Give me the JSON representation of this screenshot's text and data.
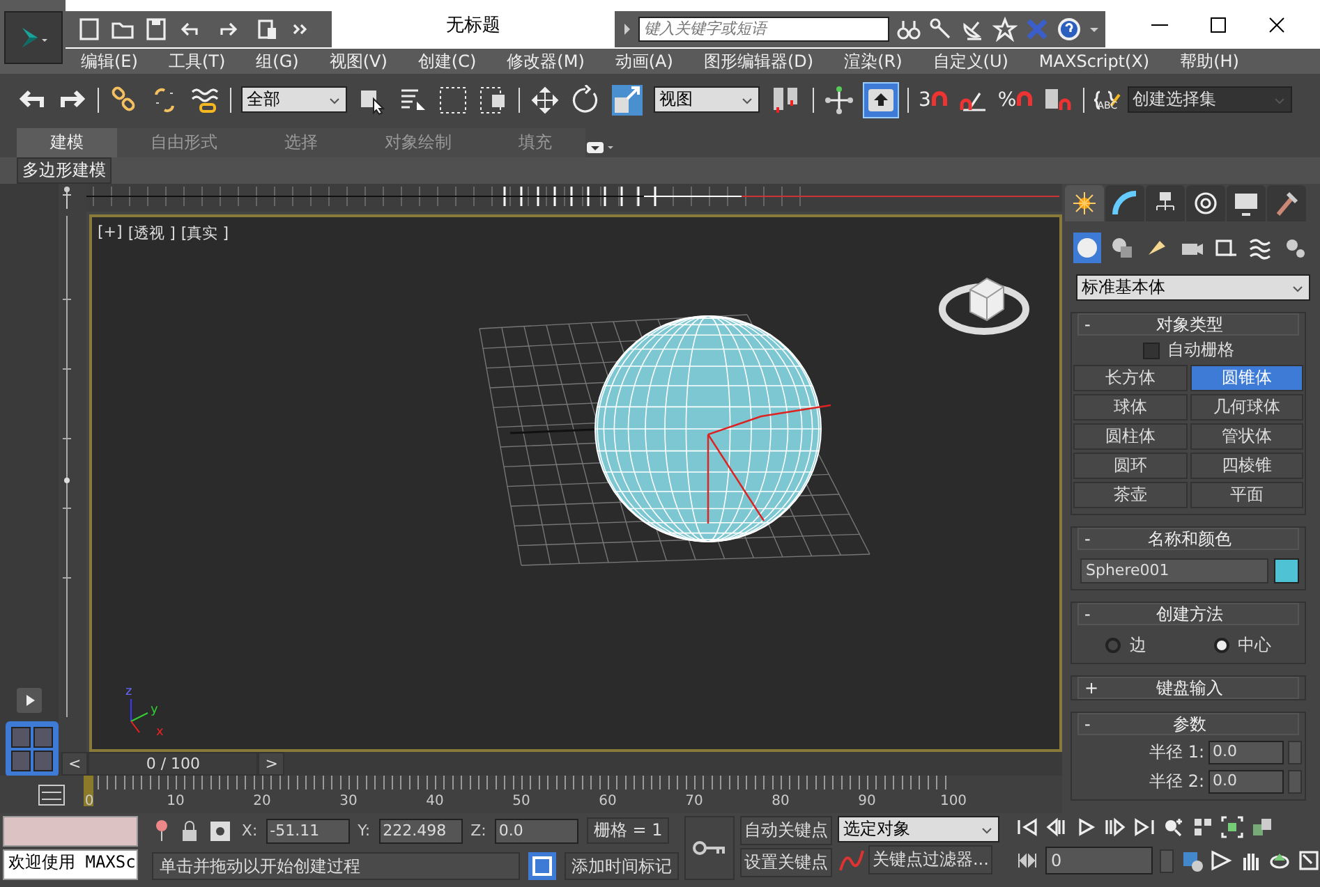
{
  "title_bar": {
    "title": "无标题",
    "search": {
      "placeholder": "键入关键字或短语"
    }
  },
  "menu": [
    "编辑(E)",
    "工具(T)",
    "组(G)",
    "视图(V)",
    "创建(C)",
    "修改器(M)",
    "动画(A)",
    "图形编辑器(D)",
    "渲染(R)",
    "自定义(U)",
    "MAXScript(X)",
    "帮助(H)"
  ],
  "toolbar": {
    "selection_filter": "全部",
    "reference_coord": "视图",
    "named_selection": "创建选择集",
    "keyboard_override": {
      "on": true
    },
    "snap_label": "3",
    "percent_label": "%",
    "named_sets_label": "ABC"
  },
  "ribbon": {
    "tabs": [
      {
        "label": "建模",
        "selected": true
      },
      {
        "label": "自由形式",
        "selected": false
      },
      {
        "label": "选择",
        "selected": false
      },
      {
        "label": "对象绘制",
        "selected": false
      },
      {
        "label": "填充",
        "selected": false
      }
    ],
    "panel_label": "多边形建模"
  },
  "viewport": {
    "labels": [
      "[+]",
      "[透视 ]",
      "[真实 ]"
    ],
    "axis_labels": [
      "x",
      "y",
      "z"
    ]
  },
  "command_panel": {
    "tabs": [
      {
        "kind": "create",
        "selected": true
      },
      {
        "kind": "modify",
        "selected": false
      },
      {
        "kind": "hierarchy",
        "selected": false
      },
      {
        "kind": "motion",
        "selected": false
      },
      {
        "kind": "display",
        "selected": false
      },
      {
        "kind": "utilities",
        "selected": false
      }
    ],
    "subtabs": [
      {
        "kind": "geometry",
        "selected": true
      },
      {
        "kind": "shapes",
        "selected": false
      },
      {
        "kind": "lights",
        "selected": false
      },
      {
        "kind": "cameras",
        "selected": false
      },
      {
        "kind": "helpers",
        "selected": false
      },
      {
        "kind": "spacewarps",
        "selected": false
      },
      {
        "kind": "systems",
        "selected": false
      }
    ],
    "category": "标准基本体",
    "rollouts": [
      {
        "kind": "object_type",
        "sign": "-",
        "title": "对象类型",
        "auto_grid": {
          "label": "自动栅格",
          "checked": false
        },
        "buttons": [
          {
            "label": "长方体",
            "selected": false
          },
          {
            "label": "圆锥体",
            "selected": true
          },
          {
            "label": "球体",
            "selected": false
          },
          {
            "label": "几何球体",
            "selected": false
          },
          {
            "label": "圆柱体",
            "selected": false
          },
          {
            "label": "管状体",
            "selected": false
          },
          {
            "label": "圆环",
            "selected": false
          },
          {
            "label": "四棱锥",
            "selected": false
          },
          {
            "label": "茶壶",
            "selected": false
          },
          {
            "label": "平面",
            "selected": false
          }
        ]
      },
      {
        "kind": "name_color",
        "sign": "-",
        "title": "名称和颜色",
        "name": "Sphere001",
        "color": "#4fc3d3"
      },
      {
        "kind": "creation_method",
        "sign": "-",
        "title": "创建方法",
        "options": [
          {
            "label": "边",
            "selected": false
          },
          {
            "label": "中心",
            "selected": true
          }
        ]
      },
      {
        "kind": "collapsed",
        "sign": "+",
        "title": "键盘输入"
      },
      {
        "kind": "parameters",
        "sign": "-",
        "title": "参数",
        "fields": [
          {
            "label": "半径 1:",
            "value": "0.0"
          },
          {
            "label": "半径 2:",
            "value": "0.0"
          }
        ]
      }
    ]
  },
  "time_slider": {
    "prev": "<",
    "position": "0 / 100",
    "next": ">"
  },
  "track_bar": {
    "ticks": [
      "0",
      "10",
      "20",
      "30",
      "40",
      "50",
      "60",
      "70",
      "80",
      "90",
      "100"
    ]
  },
  "status": {
    "listener": "欢迎使用 MAXSc",
    "prompt": "单击并拖动以开始创建过程",
    "coords": [
      {
        "label": "X:",
        "value": "-51.11"
      },
      {
        "label": "Y:",
        "value": "222.498"
      },
      {
        "label": "Z:",
        "value": "0.0"
      }
    ],
    "grid": "栅格 = 1",
    "time_tag": "添加时间标记",
    "auto_key": "自动关键点",
    "set_key": "设置关键点",
    "key_set": "选定对象",
    "key_filters": "关键点过滤器...",
    "frame": "0"
  }
}
